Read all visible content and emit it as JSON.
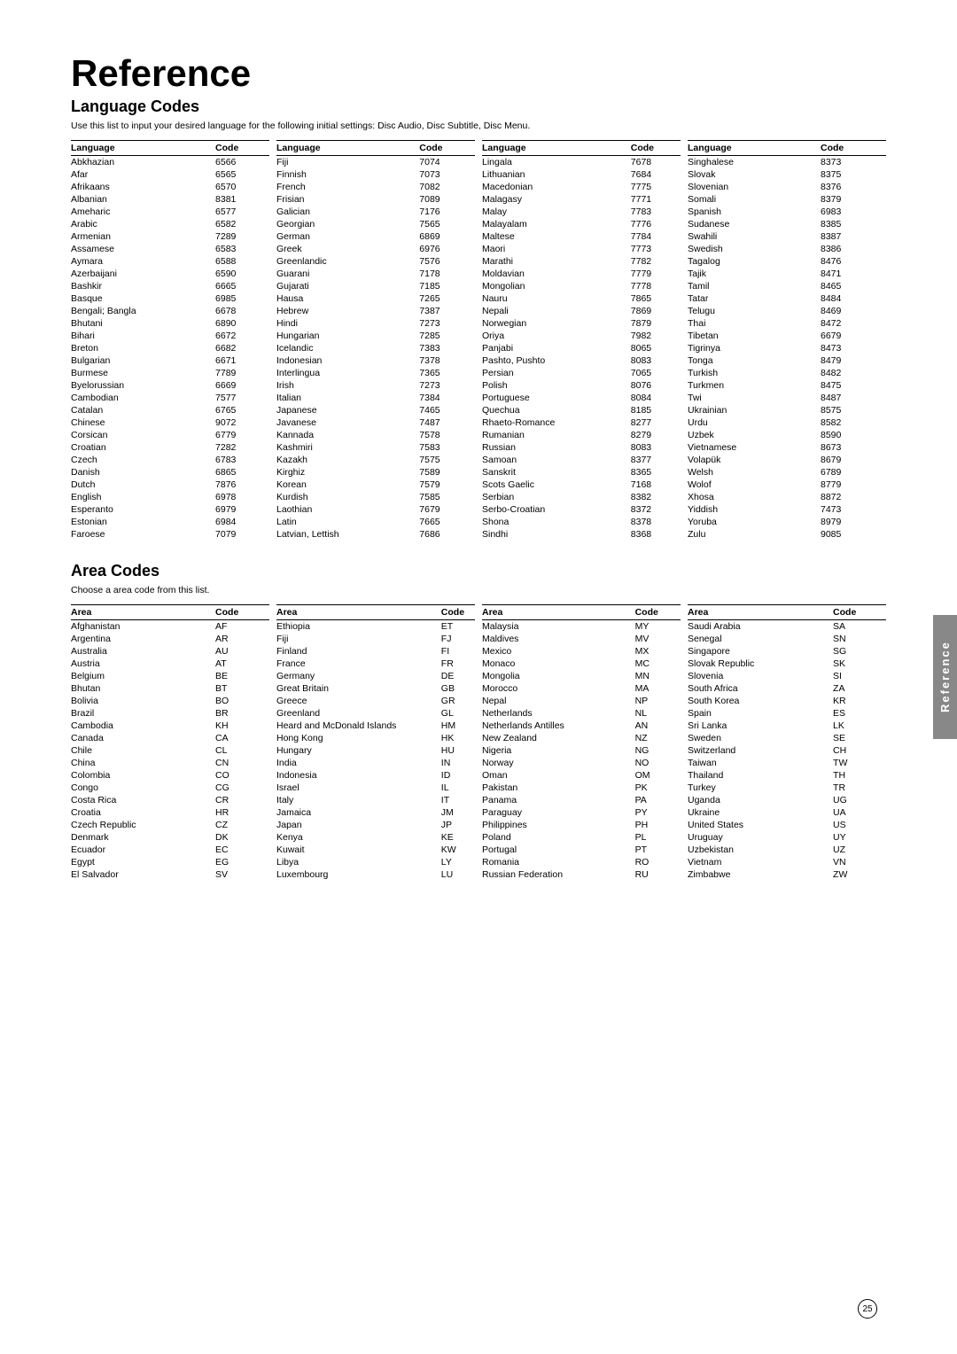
{
  "page": {
    "title": "Reference",
    "page_number": "25",
    "side_tab": "Reference"
  },
  "language_section": {
    "title": "Language Codes",
    "description": "Use this list to input your desired language for the following initial settings:\nDisc Audio, Disc Subtitle, Disc Menu.",
    "col_headers": [
      "Language",
      "Code",
      "Language",
      "Code",
      "Language",
      "Code",
      "Language",
      "Code"
    ],
    "columns": [
      [
        [
          "Abkhazian",
          "6566"
        ],
        [
          "Afar",
          "6565"
        ],
        [
          "Afrikaans",
          "6570"
        ],
        [
          "Albanian",
          "8381"
        ],
        [
          "Ameharic",
          "6577"
        ],
        [
          "Arabic",
          "6582"
        ],
        [
          "Armenian",
          "7289"
        ],
        [
          "Assamese",
          "6583"
        ],
        [
          "Aymara",
          "6588"
        ],
        [
          "Azerbaijani",
          "6590"
        ],
        [
          "Bashkir",
          "6665"
        ],
        [
          "Basque",
          "6985"
        ],
        [
          "Bengali; Bangla",
          "6678"
        ],
        [
          "Bhutani",
          "6890"
        ],
        [
          "Bihari",
          "6672"
        ],
        [
          "Breton",
          "6682"
        ],
        [
          "Bulgarian",
          "6671"
        ],
        [
          "Burmese",
          "7789"
        ],
        [
          "Byelorussian",
          "6669"
        ],
        [
          "Cambodian",
          "7577"
        ],
        [
          "Catalan",
          "6765"
        ],
        [
          "Chinese",
          "9072"
        ],
        [
          "Corsican",
          "6779"
        ],
        [
          "Croatian",
          "7282"
        ],
        [
          "Czech",
          "6783"
        ],
        [
          "Danish",
          "6865"
        ],
        [
          "Dutch",
          "7876"
        ],
        [
          "English",
          "6978"
        ],
        [
          "Esperanto",
          "6979"
        ],
        [
          "Estonian",
          "6984"
        ],
        [
          "Faroese",
          "7079"
        ]
      ],
      [
        [
          "Fiji",
          "7074"
        ],
        [
          "Finnish",
          "7073"
        ],
        [
          "French",
          "7082"
        ],
        [
          "Frisian",
          "7089"
        ],
        [
          "Galician",
          "7176"
        ],
        [
          "Georgian",
          "7565"
        ],
        [
          "German",
          "6869"
        ],
        [
          "Greek",
          "6976"
        ],
        [
          "Greenlandic",
          "7576"
        ],
        [
          "Guarani",
          "7178"
        ],
        [
          "Gujarati",
          "7185"
        ],
        [
          "Hausa",
          "7265"
        ],
        [
          "Hebrew",
          "7387"
        ],
        [
          "Hindi",
          "7273"
        ],
        [
          "Hungarian",
          "7285"
        ],
        [
          "Icelandic",
          "7383"
        ],
        [
          "Indonesian",
          "7378"
        ],
        [
          "Interlingua",
          "7365"
        ],
        [
          "Irish",
          "7273"
        ],
        [
          "Italian",
          "7384"
        ],
        [
          "Japanese",
          "7465"
        ],
        [
          "Javanese",
          "7487"
        ],
        [
          "Kannada",
          "7578"
        ],
        [
          "Kashmiri",
          "7583"
        ],
        [
          "Kazakh",
          "7575"
        ],
        [
          "Kirghiz",
          "7589"
        ],
        [
          "Korean",
          "7579"
        ],
        [
          "Kurdish",
          "7585"
        ],
        [
          "Laothian",
          "7679"
        ],
        [
          "Latin",
          "7665"
        ],
        [
          "Latvian, Lettish",
          "7686"
        ]
      ],
      [
        [
          "Lingala",
          "7678"
        ],
        [
          "Lithuanian",
          "7684"
        ],
        [
          "Macedonian",
          "7775"
        ],
        [
          "Malagasy",
          "7771"
        ],
        [
          "Malay",
          "7783"
        ],
        [
          "Malayalam",
          "7776"
        ],
        [
          "Maltese",
          "7784"
        ],
        [
          "Maori",
          "7773"
        ],
        [
          "Marathi",
          "7782"
        ],
        [
          "Moldavian",
          "7779"
        ],
        [
          "Mongolian",
          "7778"
        ],
        [
          "Nauru",
          "7865"
        ],
        [
          "Nepali",
          "7869"
        ],
        [
          "Norwegian",
          "7879"
        ],
        [
          "Oriya",
          "7982"
        ],
        [
          "Panjabi",
          "8065"
        ],
        [
          "Pashto, Pushto",
          "8083"
        ],
        [
          "Persian",
          "7065"
        ],
        [
          "Polish",
          "8076"
        ],
        [
          "Portuguese",
          "8084"
        ],
        [
          "Quechua",
          "8185"
        ],
        [
          "Rhaeto-Romance",
          "8277"
        ],
        [
          "Rumanian",
          "8279"
        ],
        [
          "Russian",
          "8083"
        ],
        [
          "Samoan",
          "8377"
        ],
        [
          "Sanskrit",
          "8365"
        ],
        [
          "Scots Gaelic",
          "7168"
        ],
        [
          "Serbian",
          "8382"
        ],
        [
          "Serbo-Croatian",
          "8372"
        ],
        [
          "Shona",
          "8378"
        ],
        [
          "Sindhi",
          "8368"
        ]
      ],
      [
        [
          "Singhalese",
          "8373"
        ],
        [
          "Slovak",
          "8375"
        ],
        [
          "Slovenian",
          "8376"
        ],
        [
          "Somali",
          "8379"
        ],
        [
          "Spanish",
          "6983"
        ],
        [
          "Sudanese",
          "8385"
        ],
        [
          "Swahili",
          "8387"
        ],
        [
          "Swedish",
          "8386"
        ],
        [
          "Tagalog",
          "8476"
        ],
        [
          "Tajik",
          "8471"
        ],
        [
          "Tamil",
          "8465"
        ],
        [
          "Tatar",
          "8484"
        ],
        [
          "Telugu",
          "8469"
        ],
        [
          "Thai",
          "8472"
        ],
        [
          "Tibetan",
          "6679"
        ],
        [
          "Tigrinya",
          "8473"
        ],
        [
          "Tonga",
          "8479"
        ],
        [
          "Turkish",
          "8482"
        ],
        [
          "Turkmen",
          "8475"
        ],
        [
          "Twi",
          "8487"
        ],
        [
          "Ukrainian",
          "8575"
        ],
        [
          "Urdu",
          "8582"
        ],
        [
          "Uzbek",
          "8590"
        ],
        [
          "Vietnamese",
          "8673"
        ],
        [
          "Volapük",
          "8679"
        ],
        [
          "Welsh",
          "6789"
        ],
        [
          "Wolof",
          "8779"
        ],
        [
          "Xhosa",
          "8872"
        ],
        [
          "Yiddish",
          "7473"
        ],
        [
          "Yoruba",
          "8979"
        ],
        [
          "Zulu",
          "9085"
        ]
      ]
    ]
  },
  "area_section": {
    "title": "Area Codes",
    "description": "Choose a area code from this list.",
    "col_headers": [
      "Area",
      "Code",
      "Area",
      "Code",
      "Area",
      "Code",
      "Area",
      "Code"
    ],
    "columns": [
      [
        [
          "Afghanistan",
          "AF"
        ],
        [
          "Argentina",
          "AR"
        ],
        [
          "Australia",
          "AU"
        ],
        [
          "Austria",
          "AT"
        ],
        [
          "Belgium",
          "BE"
        ],
        [
          "Bhutan",
          "BT"
        ],
        [
          "Bolivia",
          "BO"
        ],
        [
          "Brazil",
          "BR"
        ],
        [
          "Cambodia",
          "KH"
        ],
        [
          "Canada",
          "CA"
        ],
        [
          "Chile",
          "CL"
        ],
        [
          "China",
          "CN"
        ],
        [
          "Colombia",
          "CO"
        ],
        [
          "Congo",
          "CG"
        ],
        [
          "Costa Rica",
          "CR"
        ],
        [
          "Croatia",
          "HR"
        ],
        [
          "Czech Republic",
          "CZ"
        ],
        [
          "Denmark",
          "DK"
        ],
        [
          "Ecuador",
          "EC"
        ],
        [
          "Egypt",
          "EG"
        ],
        [
          "El Salvador",
          "SV"
        ]
      ],
      [
        [
          "Ethiopia",
          "ET"
        ],
        [
          "Fiji",
          "FJ"
        ],
        [
          "Finland",
          "FI"
        ],
        [
          "France",
          "FR"
        ],
        [
          "Germany",
          "DE"
        ],
        [
          "Great Britain",
          "GB"
        ],
        [
          "Greece",
          "GR"
        ],
        [
          "Greenland",
          "GL"
        ],
        [
          "Heard and McDonald Islands",
          "HM"
        ],
        [
          "Hong Kong",
          "HK"
        ],
        [
          "Hungary",
          "HU"
        ],
        [
          "India",
          "IN"
        ],
        [
          "Indonesia",
          "ID"
        ],
        [
          "Israel",
          "IL"
        ],
        [
          "Italy",
          "IT"
        ],
        [
          "Jamaica",
          "JM"
        ],
        [
          "Japan",
          "JP"
        ],
        [
          "Kenya",
          "KE"
        ],
        [
          "Kuwait",
          "KW"
        ],
        [
          "Libya",
          "LY"
        ],
        [
          "Luxembourg",
          "LU"
        ]
      ],
      [
        [
          "Malaysia",
          "MY"
        ],
        [
          "Maldives",
          "MV"
        ],
        [
          "Mexico",
          "MX"
        ],
        [
          "Monaco",
          "MC"
        ],
        [
          "Mongolia",
          "MN"
        ],
        [
          "Morocco",
          "MA"
        ],
        [
          "Nepal",
          "NP"
        ],
        [
          "Netherlands",
          "NL"
        ],
        [
          "Netherlands Antilles",
          "AN"
        ],
        [
          "New Zealand",
          "NZ"
        ],
        [
          "Nigeria",
          "NG"
        ],
        [
          "Norway",
          "NO"
        ],
        [
          "Oman",
          "OM"
        ],
        [
          "Pakistan",
          "PK"
        ],
        [
          "Panama",
          "PA"
        ],
        [
          "Paraguay",
          "PY"
        ],
        [
          "Philippines",
          "PH"
        ],
        [
          "Poland",
          "PL"
        ],
        [
          "Portugal",
          "PT"
        ],
        [
          "Romania",
          "RO"
        ],
        [
          "Russian Federation",
          "RU"
        ]
      ],
      [
        [
          "Saudi Arabia",
          "SA"
        ],
        [
          "Senegal",
          "SN"
        ],
        [
          "Singapore",
          "SG"
        ],
        [
          "Slovak Republic",
          "SK"
        ],
        [
          "Slovenia",
          "SI"
        ],
        [
          "South Africa",
          "ZA"
        ],
        [
          "South Korea",
          "KR"
        ],
        [
          "Spain",
          "ES"
        ],
        [
          "Sri Lanka",
          "LK"
        ],
        [
          "Sweden",
          "SE"
        ],
        [
          "Switzerland",
          "CH"
        ],
        [
          "Taiwan",
          "TW"
        ],
        [
          "Thailand",
          "TH"
        ],
        [
          "Turkey",
          "TR"
        ],
        [
          "Uganda",
          "UG"
        ],
        [
          "Ukraine",
          "UA"
        ],
        [
          "United States",
          "US"
        ],
        [
          "Uruguay",
          "UY"
        ],
        [
          "Uzbekistan",
          "UZ"
        ],
        [
          "Vietnam",
          "VN"
        ],
        [
          "Zimbabwe",
          "ZW"
        ]
      ]
    ]
  }
}
